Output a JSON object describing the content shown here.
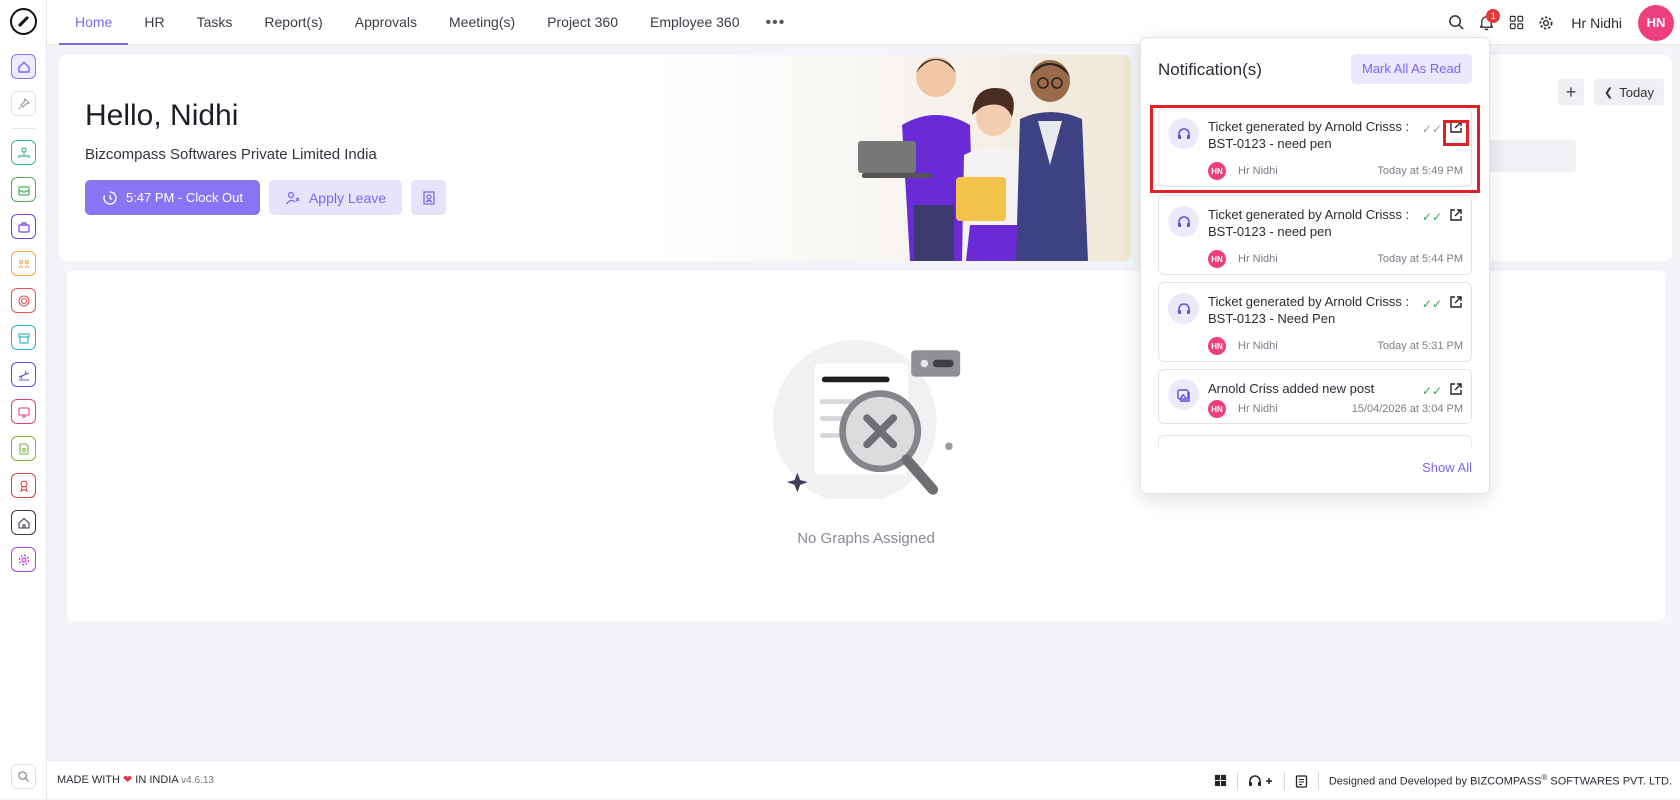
{
  "nav": {
    "items": [
      "Home",
      "HR",
      "Tasks",
      "Report(s)",
      "Approvals",
      "Meeting(s)",
      "Project 360",
      "Employee 360"
    ],
    "active_index": 0,
    "more_label": "•••"
  },
  "topbar": {
    "notification_count": "1",
    "user_name": "Hr Nidhi",
    "avatar_initials": "HN"
  },
  "hero": {
    "greeting": "Hello, Nidhi",
    "company": "Bizcompass Softwares Private Limited India",
    "clock_label": "5:47 PM - Clock Out",
    "leave_label": "Apply Leave"
  },
  "calendar": {
    "today_label": "Today",
    "add_label": "+"
  },
  "graphs": {
    "empty_label": "No Graphs Assigned"
  },
  "notifications": {
    "title": "Notification(s)",
    "mark_all_label": "Mark All As Read",
    "show_all_label": "Show All",
    "items": [
      {
        "text": "Ticket generated by Arnold Crisss : BST-0123 - need pen",
        "author_initials": "HN",
        "author": "Hr Nidhi",
        "time": "Today at 5:49 PM",
        "read": false
      },
      {
        "text": "Ticket generated by Arnold Crisss : BST-0123 - need pen",
        "author_initials": "HN",
        "author": "Hr Nidhi",
        "time": "Today at 5:44 PM",
        "read": true
      },
      {
        "text": "Ticket generated by Arnold Crisss : BST-0123 - Need Pen",
        "author_initials": "HN",
        "author": "Hr Nidhi",
        "time": "Today at 5:31 PM",
        "read": true
      },
      {
        "text": "Arnold Criss added new post",
        "author_initials": "HN",
        "author": "Hr Nidhi",
        "time": "15/04/2026 at 3:04 PM",
        "read": true
      }
    ]
  },
  "footer": {
    "made_with_prefix": "MADE WITH",
    "made_with_suffix": "IN INDIA",
    "version": "v4.6.13",
    "designed_by": "Designed and Developed by",
    "company": "BIZCOMPASS",
    "company_suffix": "SOFTWARES PVT. LTD.",
    "reg_mark": "®"
  },
  "colors": {
    "accent": "#7b66f0",
    "accent_light": "#e7e3fb",
    "avatar": "#ee3f7f",
    "badge": "#e23a3a",
    "highlight": "#e01f26"
  },
  "rail_icons": [
    "home-icon",
    "pin-icon",
    "org-chart-icon",
    "inbox-icon",
    "briefcase-icon",
    "team-icon",
    "target-icon",
    "archive-icon",
    "travel-icon",
    "presentation-icon",
    "document-icon",
    "award-icon",
    "house-icon",
    "settings-icon",
    "search-icon"
  ]
}
